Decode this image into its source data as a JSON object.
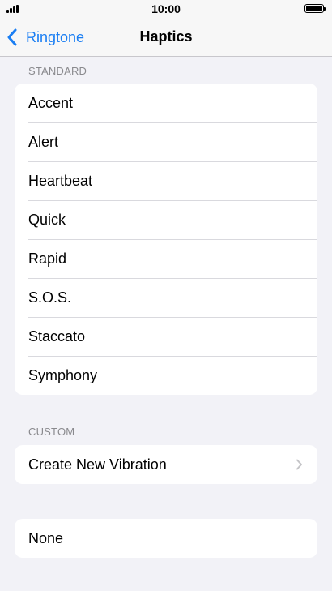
{
  "status_bar": {
    "time": "10:00",
    "signal_icon": "cellular-signal-icon",
    "battery_icon": "battery-full-icon"
  },
  "nav": {
    "back_label": "Ringtone",
    "title": "Haptics",
    "back_icon": "chevron-left-icon"
  },
  "standard": {
    "header": "STANDARD",
    "items": [
      {
        "label": "Accent"
      },
      {
        "label": "Alert"
      },
      {
        "label": "Heartbeat"
      },
      {
        "label": "Quick"
      },
      {
        "label": "Rapid"
      },
      {
        "label": "S.O.S."
      },
      {
        "label": "Staccato"
      },
      {
        "label": "Symphony"
      }
    ]
  },
  "custom": {
    "header": "CUSTOM",
    "create_label": "Create New Vibration",
    "chevron_icon": "chevron-right-icon"
  },
  "none_group": {
    "label": "None"
  },
  "colors": {
    "accent": "#1a7ef3",
    "background": "#f2f2f7",
    "group_background": "#ffffff",
    "section_header": "#8a8a8e"
  }
}
